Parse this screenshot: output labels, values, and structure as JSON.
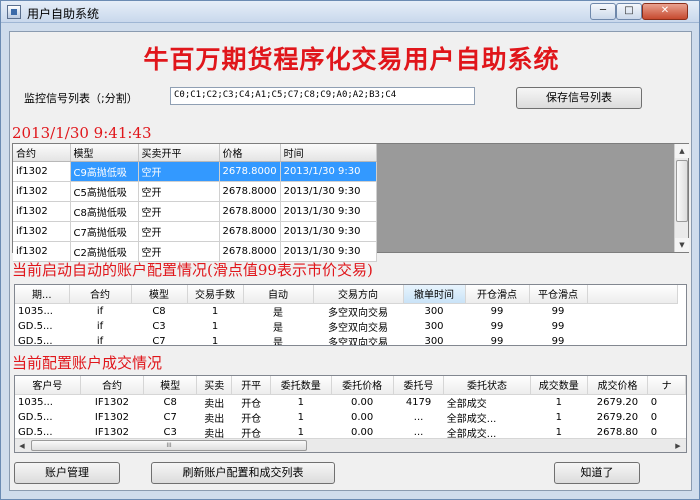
{
  "window": {
    "title": "用户自助系统",
    "controls": {
      "minimize": "─",
      "maximize": "□",
      "close": "✕"
    }
  },
  "header": {
    "app_title": "牛百万期货程序化交易用户自助系统"
  },
  "signals": {
    "label": "监控信号列表（;分割）",
    "value": "C0;C1;C2;C3;C4;A1;C5;C7;C8;C9;A0;A2;B3;C4",
    "save_button": "保存信号列表"
  },
  "signal_panel": {
    "datetime": "2013/1/30  9:41:43",
    "columns": [
      "合约",
      "模型",
      "买卖开平",
      "价格",
      "时间"
    ],
    "rows": [
      [
        "if1302",
        "C9高抛低吸",
        "空开",
        "2678.8000",
        "2013/1/30  9:30"
      ],
      [
        "if1302",
        "C5高抛低吸",
        "空开",
        "2678.8000",
        "2013/1/30  9:30"
      ],
      [
        "if1302",
        "C8高抛低吸",
        "空开",
        "2678.8000",
        "2013/1/30  9:30"
      ],
      [
        "if1302",
        "C7高抛低吸",
        "空开",
        "2678.8000",
        "2013/1/30  9:30"
      ],
      [
        "if1302",
        "C2高抛低吸",
        "空开",
        "2678.8000",
        "2013/1/30  9:30"
      ]
    ]
  },
  "config_panel": {
    "title": "当前启动自动的账户配置情况(滑点值99表示市价交易)",
    "columns": [
      "期...",
      "合约",
      "模型",
      "交易手数",
      "自动",
      "交易方向",
      "撤单时间",
      "开仓滑点",
      "平仓滑点"
    ],
    "rows": [
      [
        "1035...",
        "if",
        "C8",
        "1",
        "是",
        "多空双向交易",
        "300",
        "99",
        "99"
      ],
      [
        "GD.5...",
        "if",
        "C3",
        "1",
        "是",
        "多空双向交易",
        "300",
        "99",
        "99"
      ],
      [
        "GD.5...",
        "if",
        "C7",
        "1",
        "是",
        "多空双向交易",
        "300",
        "99",
        "99"
      ]
    ]
  },
  "trades_panel": {
    "title": "当前配置账户成交情况",
    "columns": [
      "客户号",
      "合约",
      "模型",
      "买卖",
      "开平",
      "委托数量",
      "委托价格",
      "委托号",
      "委托状态",
      "成交数量",
      "成交价格",
      "ナ"
    ],
    "rows": [
      [
        "1035...",
        "IF1302",
        "C8",
        "卖出",
        "开仓",
        "1",
        "0.00",
        "4179",
        "全部成交",
        "1",
        "2679.20",
        "0"
      ],
      [
        "GD.5...",
        "IF1302",
        "C7",
        "卖出",
        "开仓",
        "1",
        "0.00",
        "...",
        "全部成交...",
        "1",
        "2679.20",
        "0"
      ],
      [
        "GD.5...",
        "IF1302",
        "C3",
        "卖出",
        "开仓",
        "1",
        "0.00",
        "...",
        "全部成交...",
        "1",
        "2678.80",
        "0"
      ]
    ],
    "scroll_grip": "III"
  },
  "footer": {
    "account_button": "账户管理",
    "refresh_button": "刷新账户配置和成交列表",
    "ok_button": "知道了"
  },
  "scroll_glyphs": {
    "up": "▲",
    "down": "▼",
    "left": "◀",
    "right": "▶"
  }
}
